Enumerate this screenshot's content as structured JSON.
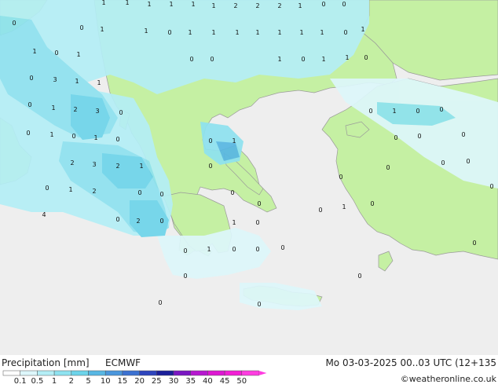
{
  "title": "Precipitation [mm]",
  "model": "ECMWF",
  "valid_time": "Mo 03-03-2025 00..03 UTC (12+135",
  "credit": "©weatheronline.co.uk",
  "legend": {
    "tick_labels": [
      "0.1",
      "0.5",
      "1",
      "2",
      "5",
      "10",
      "15",
      "20",
      "25",
      "30",
      "35",
      "40",
      "45",
      "50"
    ],
    "colors": [
      "#ffffff",
      "#ddf7fb",
      "#b4eef6",
      "#8ee2f0",
      "#6dd4ea",
      "#58b7e3",
      "#4a96dc",
      "#3c72d1",
      "#2e45bd",
      "#1b1f9a",
      "#7a17c2",
      "#b718d0",
      "#dd18d2",
      "#f21fd5",
      "#ff3de0"
    ]
  },
  "colors": {
    "land": "#c5f0a3",
    "sea": "#eeeeee",
    "coast": "#9a9a9a"
  },
  "point_values": [
    {
      "v": "1"
    },
    {
      "v": "1"
    },
    {
      "v": "1"
    },
    {
      "v": "1"
    },
    {
      "v": "1"
    },
    {
      "v": "1"
    },
    {
      "v": "2"
    },
    {
      "v": "2"
    },
    {
      "v": "2"
    },
    {
      "v": "1"
    },
    {
      "v": "0"
    },
    {
      "v": "0"
    },
    {
      "v": "0"
    },
    {
      "v": "0"
    },
    {
      "v": "1"
    },
    {
      "v": "1"
    },
    {
      "v": "0"
    },
    {
      "v": "1"
    },
    {
      "v": "1"
    },
    {
      "v": "1"
    },
    {
      "v": "1"
    },
    {
      "v": "1"
    },
    {
      "v": "1"
    },
    {
      "v": "1"
    },
    {
      "v": "1"
    },
    {
      "v": "0"
    },
    {
      "v": "1"
    },
    {
      "v": "0"
    },
    {
      "v": "1"
    },
    {
      "v": "0"
    },
    {
      "v": "0"
    },
    {
      "v": "1"
    },
    {
      "v": "0"
    },
    {
      "v": "1"
    },
    {
      "v": "1"
    },
    {
      "v": "0"
    },
    {
      "v": "0"
    },
    {
      "v": "3"
    },
    {
      "v": "1"
    },
    {
      "v": "1"
    },
    {
      "v": "0"
    },
    {
      "v": "1"
    },
    {
      "v": "2"
    },
    {
      "v": "3"
    },
    {
      "v": "0"
    },
    {
      "v": "0"
    },
    {
      "v": "1"
    },
    {
      "v": "0"
    },
    {
      "v": "0"
    },
    {
      "v": "0"
    },
    {
      "v": "1"
    },
    {
      "v": "0"
    },
    {
      "v": "1"
    },
    {
      "v": "0"
    },
    {
      "v": "0"
    },
    {
      "v": "1"
    },
    {
      "v": "0"
    },
    {
      "v": "0"
    },
    {
      "v": "0"
    },
    {
      "v": "2"
    },
    {
      "v": "3"
    },
    {
      "v": "2"
    },
    {
      "v": "1"
    },
    {
      "v": "0"
    },
    {
      "v": "0"
    },
    {
      "v": "0"
    },
    {
      "v": "0"
    },
    {
      "v": "0"
    },
    {
      "v": "0"
    },
    {
      "v": "0"
    },
    {
      "v": "1"
    },
    {
      "v": "2"
    },
    {
      "v": "0"
    },
    {
      "v": "0"
    },
    {
      "v": "0"
    },
    {
      "v": "0"
    },
    {
      "v": "0"
    },
    {
      "v": "1"
    },
    {
      "v": "0"
    },
    {
      "v": "4"
    },
    {
      "v": "2"
    },
    {
      "v": "0"
    },
    {
      "v": "0"
    },
    {
      "v": "1"
    },
    {
      "v": "0"
    },
    {
      "v": "0"
    },
    {
      "v": "1"
    },
    {
      "v": "0"
    },
    {
      "v": "0"
    },
    {
      "v": "0"
    },
    {
      "v": "0"
    },
    {
      "v": "0"
    },
    {
      "v": "0"
    },
    {
      "v": "0"
    },
    {
      "v": "0"
    }
  ]
}
